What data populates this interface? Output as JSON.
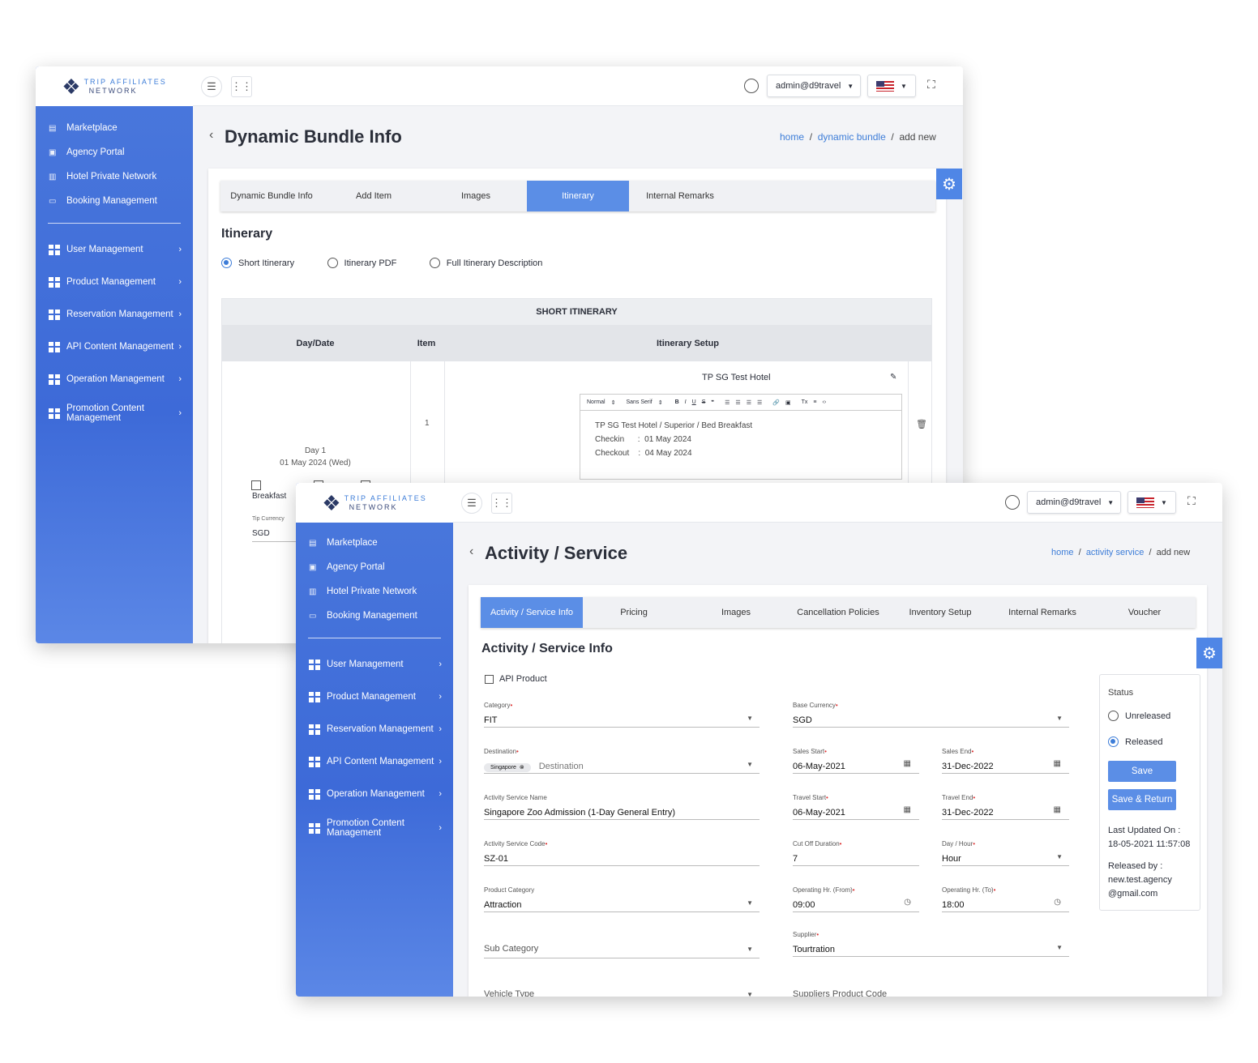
{
  "w1": {
    "logo": {
      "line1": "TRIP AFFILIATES",
      "line2": "NETWORK"
    },
    "menu_top": [
      "Marketplace",
      "Agency Portal",
      "Hotel Private Network",
      "Booking Management"
    ],
    "menu_main": [
      "User Management",
      "Product Management",
      "Reservation Management",
      "API Content Management",
      "Operation Management",
      "Promotion Content Management"
    ],
    "user": "admin@d9travel",
    "title": "Dynamic Bundle Info",
    "bc": {
      "home": "home",
      "mid": "dynamic bundle",
      "cur": "add new"
    },
    "tabs": [
      "Dynamic Bundle Info",
      "Add Item",
      "Images",
      "Itinerary",
      "Internal Remarks"
    ],
    "section": "Itinerary",
    "radios": [
      "Short Itinerary",
      "Itinerary PDF",
      "Full Itinerary Description"
    ],
    "table": {
      "head": "SHORT ITINERARY",
      "cols": [
        "Day/Date",
        "Item",
        "Itinerary Setup"
      ],
      "day": "Day 1",
      "date": "01 May 2024 (Wed)",
      "item": "1",
      "hotel": "TP SG Test Hotel",
      "tb_normal": "Normal",
      "tb_font": "Sans Serif",
      "lines": [
        "TP SG Test Hotel / Superior / Bed Breakfast",
        "Checkin      :  01 May 2024",
        "Checkout    :  04 May 2024"
      ],
      "breakfast": "Breakfast",
      "tip_label": "Tip Currency",
      "tip": "SGD"
    }
  },
  "w2": {
    "logo": {
      "line1": "TRIP AFFILIATES",
      "line2": "NETWORK"
    },
    "menu_top": [
      "Marketplace",
      "Agency Portal",
      "Hotel Private Network",
      "Booking Management"
    ],
    "menu_main": [
      "User Management",
      "Product Management",
      "Reservation Management",
      "API Content Management",
      "Operation Management",
      "Promotion Content Management"
    ],
    "user": "admin@d9travel",
    "title": "Activity / Service",
    "bc": {
      "home": "home",
      "mid": "activity service",
      "cur": "add new"
    },
    "tabs": [
      "Activity / Service Info",
      "Pricing",
      "Images",
      "Cancellation Policies",
      "Inventory Setup",
      "Internal Remarks",
      "Voucher"
    ],
    "section": "Activity / Service Info",
    "api": "API Product",
    "f": {
      "cat_l": "Category",
      "cat": "FIT",
      "cur_l": "Base Currency",
      "cur": "SGD",
      "dest_l": "Destination",
      "dest_chip": "Singapore",
      "dest_ph": "Destination",
      "ss_l": "Sales Start",
      "ss": "06-May-2021",
      "se_l": "Sales End",
      "se": "31-Dec-2022",
      "name_l": "Activity Service Name",
      "name": "Singapore Zoo Admission (1-Day General Entry)",
      "ts_l": "Travel Start",
      "ts": "06-May-2021",
      "te_l": "Travel End",
      "te": "31-Dec-2022",
      "code_l": "Activity Service Code",
      "code": "SZ-01",
      "cod_l": "Cut Off Duration",
      "cod": "7",
      "dh_l": "Day / Hour",
      "dh": "Hour",
      "pc_l": "Product Category",
      "pc": "Attraction",
      "of_l": "Operating Hr. (From)",
      "of": "09:00",
      "ot_l": "Operating Hr. (To)",
      "ot": "18:00",
      "sub": "Sub Category",
      "sup_l": "Supplier",
      "sup": "Tourtration",
      "veh": "Vehicle Type",
      "spc": "Suppliers Product Code"
    },
    "status": {
      "label": "Status",
      "r1": "Unreleased",
      "r2": "Released",
      "save": "Save",
      "save_return": "Save & Return",
      "updated_l": "Last Updated On :",
      "updated": "18-05-2021 11:57:08",
      "rel_l": "Released by :",
      "rel1": "new.test.agency",
      "rel2": "@gmail.com"
    }
  },
  "colors": {
    "accent": "#5b8ee6",
    "sidebar": "#4a78dc"
  }
}
